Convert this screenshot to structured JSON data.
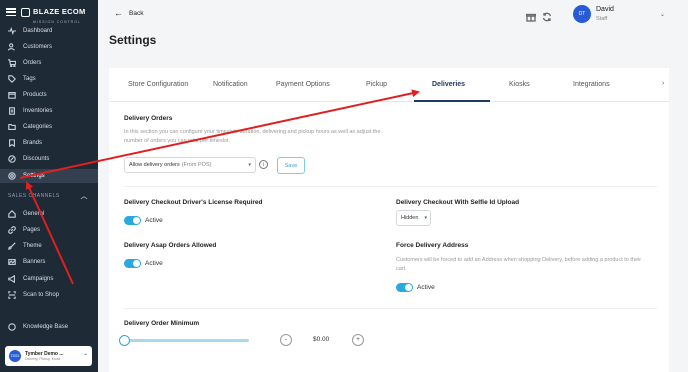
{
  "brand": {
    "name": "BLAZE ECOM",
    "tagline": "MISSION CONTROL"
  },
  "sidebar": {
    "items": [
      {
        "label": "Dashboard",
        "icon": "activity-icon"
      },
      {
        "label": "Customers",
        "icon": "users-icon"
      },
      {
        "label": "Orders",
        "icon": "cart-icon"
      },
      {
        "label": "Tags",
        "icon": "tag-icon"
      },
      {
        "label": "Products",
        "icon": "box-icon"
      },
      {
        "label": "Inventories",
        "icon": "clipboard-icon"
      },
      {
        "label": "Categories",
        "icon": "folder-icon"
      },
      {
        "label": "Brands",
        "icon": "bookmark-icon"
      },
      {
        "label": "Discounts",
        "icon": "percent-icon"
      },
      {
        "label": "Settings",
        "icon": "gear-icon",
        "active": true
      }
    ],
    "section_label": "SALES CHANNELS",
    "channel_items": [
      {
        "label": "General",
        "icon": "home-icon"
      },
      {
        "label": "Pages",
        "icon": "link-icon"
      },
      {
        "label": "Theme",
        "icon": "brush-icon"
      },
      {
        "label": "Banners",
        "icon": "image-icon"
      },
      {
        "label": "Campaigns",
        "icon": "megaphone-icon"
      },
      {
        "label": "Scan to Shop",
        "icon": "scan-icon"
      }
    ],
    "knowledge_base": "Knowledge Base",
    "store": {
      "avatar": "TDS1",
      "name": "Tymber Demo ...",
      "subtitle": "Delivery, Pickup, Kiosk"
    }
  },
  "header": {
    "back_label": "Back",
    "user": {
      "initials": "DT",
      "name": "David",
      "role": "Staff"
    }
  },
  "page_title": "Settings",
  "tabs": [
    {
      "label": "Store Configuration"
    },
    {
      "label": "Notification"
    },
    {
      "label": "Payment Options"
    },
    {
      "label": "Pickup"
    },
    {
      "label": "Deliveries",
      "active": true
    },
    {
      "label": "Kiosks"
    },
    {
      "label": "Integrations"
    }
  ],
  "delivery_orders": {
    "title": "Delivery Orders",
    "description": "In this section you can configure your timeslots duration, delivering and pickup hours as well as adjust the number of orders you can take per timeslot.",
    "select_value": "Allow delivery orders",
    "select_hint": "(From POS)",
    "save_label": "Save"
  },
  "license_required": {
    "title": "Delivery Checkout Driver's License Required",
    "toggle_label": "Active",
    "enabled": true
  },
  "selfie_upload": {
    "title": "Delivery Checkout With Selfie Id Upload",
    "value": "Hidden"
  },
  "asap_orders": {
    "title": "Delivery Asap Orders Allowed",
    "toggle_label": "Active",
    "enabled": true
  },
  "force_address": {
    "title": "Force Delivery Address",
    "description": "Customers will be forced to add an Address when shopping Delivery, before adding a product to their cart.",
    "toggle_label": "Active",
    "enabled": true
  },
  "order_minimum": {
    "title": "Delivery Order Minimum",
    "amount": "$0.00",
    "minus": "-",
    "plus": "+",
    "level": 0
  },
  "colors": {
    "sidebar": "#1f2a37",
    "accent": "#2aa8e0",
    "annotation": "#e02020"
  }
}
